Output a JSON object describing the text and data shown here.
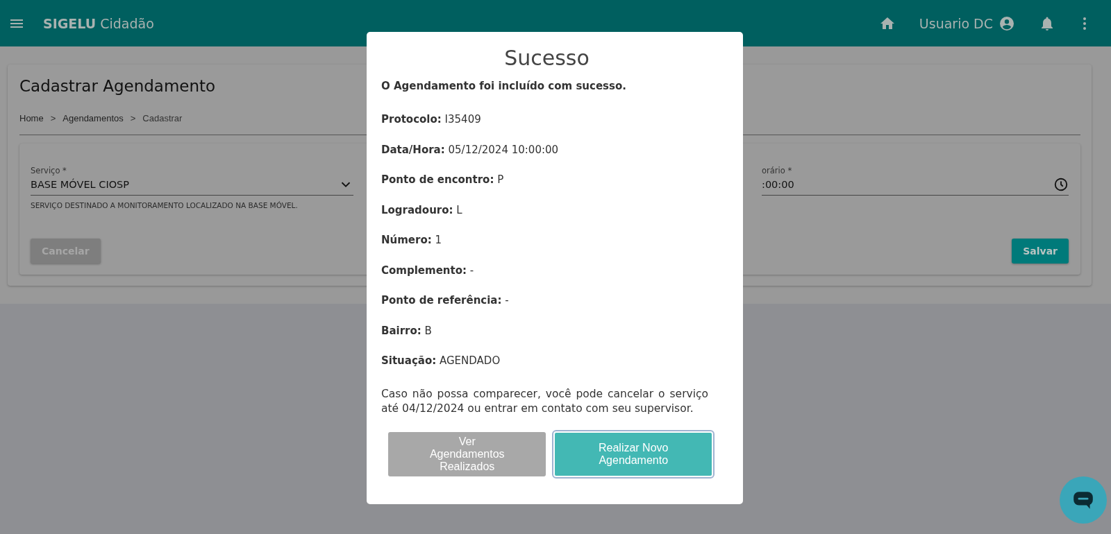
{
  "header": {
    "app_name_bold": "SIGELU",
    "app_name": "Cidadão",
    "user": "Usuario DC"
  },
  "page": {
    "title": "Cadastrar Agendamento",
    "breadcrumb": [
      {
        "label": "Home"
      },
      {
        "label": "Agendamentos"
      },
      {
        "label": "Cadastrar"
      }
    ],
    "separators": [
      ">",
      ">"
    ],
    "fields": [
      {
        "label": "Serviço *",
        "value": "BASE MÓVEL CIOSP",
        "hint": "SERVIÇO DESTINADO A MONITORAMENTO LOCALIZADO NA BASE MÓVEL.",
        "kind": "select"
      },
      {
        "label": "orário *",
        "value": ":00:00",
        "kind": "time"
      }
    ],
    "buttons": [
      {
        "label": "Cancelar",
        "kind": "secondary"
      },
      {
        "label": "Salvar",
        "kind": "primary"
      }
    ]
  },
  "dialog": {
    "title": "Sucesso",
    "message": "O Agendamento foi incluído com sucesso.",
    "details": [
      {
        "label": "Protocolo:",
        "value": "I35409"
      },
      {
        "label": "Data/Hora:",
        "value": "05/12/2024 10:00:00"
      },
      {
        "label": "Ponto de encontro:",
        "value": "P"
      },
      {
        "label": "Logradouro:",
        "value": "L"
      },
      {
        "label": "Número:",
        "value": "1"
      },
      {
        "label": "Complemento:",
        "value": "-"
      },
      {
        "label": "Ponto de referência:",
        "value": "-"
      },
      {
        "label": "Bairro:",
        "value": "B"
      },
      {
        "label": "Situação:",
        "value": "AGENDADO"
      }
    ],
    "note": "Caso não possa comparecer, você pode cancelar o serviço até 04/12/2024 ou entrar em contato com seu supervisor.",
    "buttons": [
      {
        "label": "Ver Agendamentos Realizados",
        "kind": "secondary",
        "focused": false
      },
      {
        "label": "Realizar Novo Agendamento",
        "kind": "primary",
        "focused": true
      }
    ]
  }
}
